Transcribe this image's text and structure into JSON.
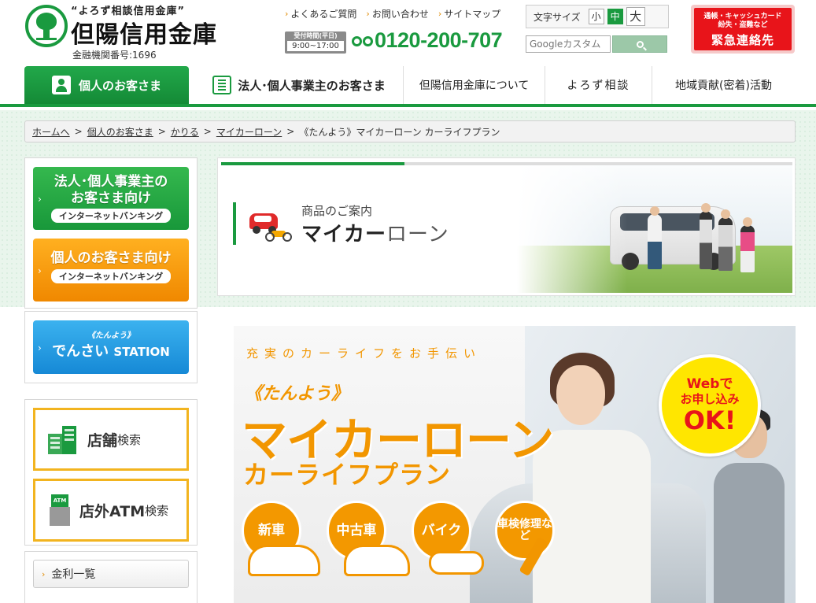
{
  "header": {
    "tagline": "“よろず相談信用金庫”",
    "bank_name": "但陽信用金庫",
    "institution_code": "金融機関番号:1696",
    "links": [
      "よくあるご質問",
      "お問い合わせ",
      "サイトマップ"
    ],
    "hours_label": "受付時間(平日)",
    "hours_time": "9:00~17:00",
    "phone": "0120-200-707",
    "font_size_label": "文字サイズ",
    "font_sizes": [
      "小",
      "中",
      "大"
    ],
    "font_size_selected": "中",
    "search_placeholder": "Googleカスタム",
    "emergency_sub1": "通帳・キャッシュカード",
    "emergency_sub2": "紛失・盗難など",
    "emergency_main": "緊急連絡先"
  },
  "nav": {
    "items": [
      "個人のお客さま",
      "法人･個人事業主のお客さま",
      "但陽信用金庫について",
      "よろず相談",
      "地域貢献(密着)活動"
    ],
    "active": "個人のお客さま"
  },
  "breadcrumb": {
    "links": [
      "ホームへ",
      "個人のお客さま",
      "かりる",
      "マイカーローン"
    ],
    "separator": ">",
    "current": "《たんよう》マイカーローン カーライフプラン"
  },
  "sidebar": {
    "corp_ib": {
      "line1": "法人･個人事業主の",
      "line2": "お客さま向け",
      "tag": "インターネットバンキング"
    },
    "personal_ib": {
      "line1": "個人のお客さま向け",
      "tag": "インターネットバンキング"
    },
    "tensai": {
      "small": "《たんよう》",
      "big": "でんさい",
      "station": "STATION"
    },
    "store_search": {
      "main": "店舗",
      "small": "検索"
    },
    "atm_search": {
      "main": "店外ATM",
      "small": "検索",
      "icon_label": "ATM"
    },
    "rate_list": "金利一覧"
  },
  "product_header": {
    "subtitle": "商品のご案内",
    "title_bold": "マイカー",
    "title_rest": "ローン"
  },
  "banner": {
    "catch": "充実のカーライフをお手伝い",
    "brand": "《たんよう》",
    "title": "マイカーローン",
    "subtitle": "カーライフプラン",
    "circles": [
      "新車",
      "中古車",
      "バイク",
      "車検修理など"
    ],
    "web_badge": {
      "line1": "Webで",
      "line2": "お申し込み",
      "line3": "OK!"
    }
  },
  "colors": {
    "brand_green": "#1a9a3f",
    "accent_orange": "#f29600",
    "emergency_red": "#e8141a",
    "badge_yellow": "#ffe600",
    "info_blue": "#1689d6"
  }
}
